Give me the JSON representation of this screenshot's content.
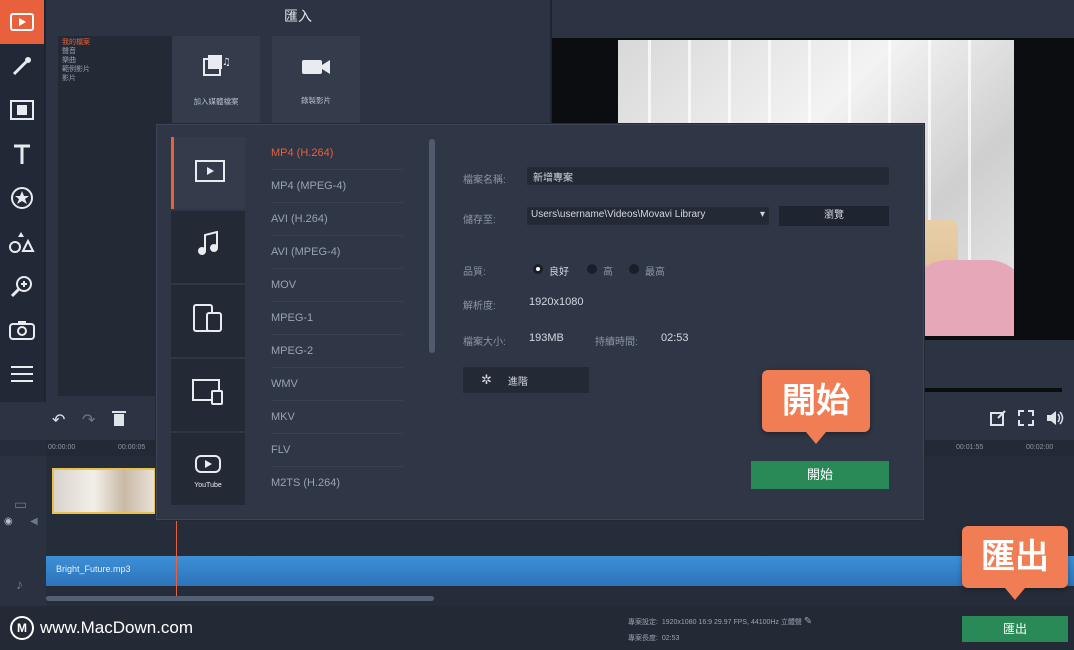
{
  "import_panel": {
    "title": "匯入",
    "categories": [
      "我的檔案",
      "聲音",
      "樂曲",
      "範例影片",
      "影片"
    ],
    "tiles": [
      {
        "icon": "add-media-icon",
        "label": "加入媒體檔案"
      },
      {
        "icon": "video-camera-icon",
        "label": "錄製影片"
      }
    ]
  },
  "export_dialog": {
    "format_tabs": [
      {
        "icon": "video-file-icon"
      },
      {
        "icon": "music-note-icon"
      },
      {
        "icon": "devices-icon"
      },
      {
        "icon": "tv-icon"
      },
      {
        "icon": "youtube-icon",
        "text": "YouTube"
      }
    ],
    "formats": [
      "MP4 (H.264)",
      "MP4 (MPEG-4)",
      "AVI (H.264)",
      "AVI (MPEG-4)",
      "MOV",
      "MPEG-1",
      "MPEG-2",
      "WMV",
      "MKV",
      "FLV",
      "M2TS (H.264)"
    ],
    "selected_format": "MP4 (H.264)",
    "filename_label": "檔案名稱:",
    "filename_value": "新增專案",
    "save_to_label": "儲存至:",
    "save_to_value": "Users\\username\\Videos\\Movavi Library",
    "browse_label": "瀏覽",
    "quality_label": "品質:",
    "quality_options": [
      "良好",
      "高",
      "最高"
    ],
    "quality_selected": "良好",
    "resolution_label": "解析度:",
    "resolution_value": "1920x1080",
    "filesize_label": "檔案大小:",
    "filesize_value": "193MB",
    "duration_label": "持續時間:",
    "duration_value": "02:53",
    "settings_label": "進階",
    "start_label": "開始"
  },
  "callouts": {
    "start": "開始",
    "export": "匯出"
  },
  "timeline": {
    "ruler_ticks": [
      "00:00:00",
      "00:00:05",
      "00:01:55",
      "00:02:00"
    ],
    "audio_clip_name": "Bright_Future.mp3",
    "project_info_label": "專案設定:",
    "project_info_value": "1920x1080 16:9 29.97 FPS, 44100Hz 立體聲",
    "project_length_label": "專案長度:",
    "project_length_value": "02:53",
    "export_label": "匯出"
  },
  "watermark": {
    "logo": "M",
    "text": "www.MacDown.com"
  },
  "colors": {
    "accent_orange": "#e8603c",
    "callout_orange": "#f07d54",
    "green_button": "#2a8a57",
    "audio_blue": "#3d8fd8"
  }
}
